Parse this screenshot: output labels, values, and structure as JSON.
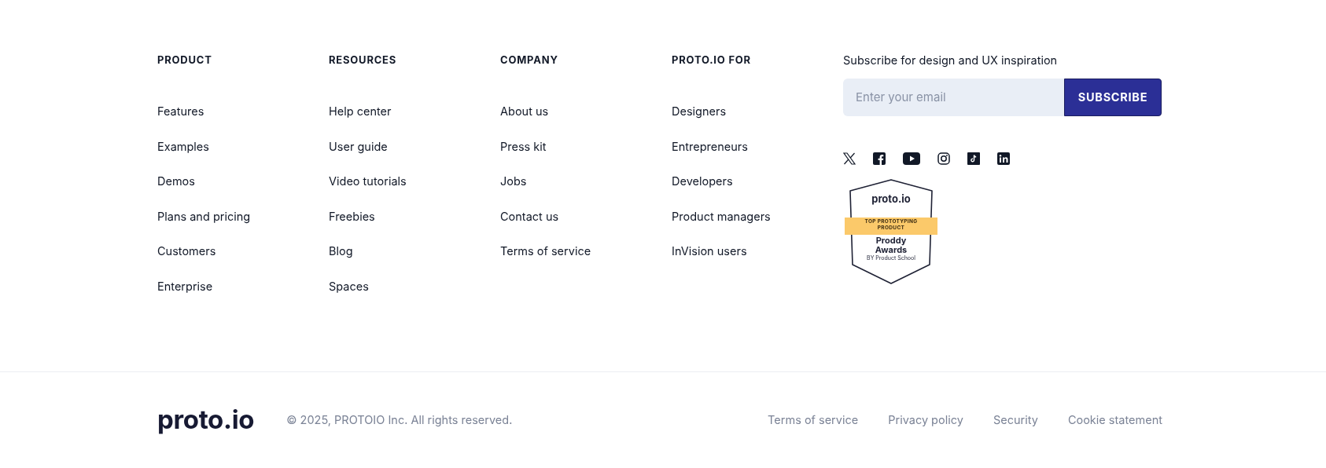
{
  "columns": [
    {
      "heading": "PRODUCT",
      "links": [
        "Features",
        "Examples",
        "Demos",
        "Plans and pricing",
        "Customers",
        "Enterprise"
      ]
    },
    {
      "heading": "RESOURCES",
      "links": [
        "Help center",
        "User guide",
        "Video tutorials",
        "Freebies",
        "Blog",
        "Spaces"
      ]
    },
    {
      "heading": "COMPANY",
      "links": [
        "About us",
        "Press kit",
        "Jobs",
        "Contact us",
        "Terms of service"
      ]
    },
    {
      "heading": "PROTO.IO FOR",
      "links": [
        "Designers",
        "Entrepreneurs",
        "Developers",
        "Product managers",
        "InVision users"
      ]
    }
  ],
  "subscribe": {
    "title": "Subscribe for design and UX inspiration",
    "placeholder": "Enter your email",
    "button": "SUBSCRIBE"
  },
  "social": [
    {
      "kind": "x"
    },
    {
      "kind": "facebook"
    },
    {
      "kind": "youtube"
    },
    {
      "kind": "instagram"
    },
    {
      "kind": "tiktok"
    },
    {
      "kind": "linkedin"
    }
  ],
  "badge": {
    "brand": "proto.io",
    "ribbon": "TOP PROTOTYPING PRODUCT",
    "title": "Proddy Awards",
    "by": "BY Product School"
  },
  "bottom": {
    "logo": "proto.io",
    "copyright": "© 2025, PROTOIO Inc. All rights reserved.",
    "links": [
      "Terms of service",
      "Privacy policy",
      "Security",
      "Cookie statement"
    ]
  }
}
